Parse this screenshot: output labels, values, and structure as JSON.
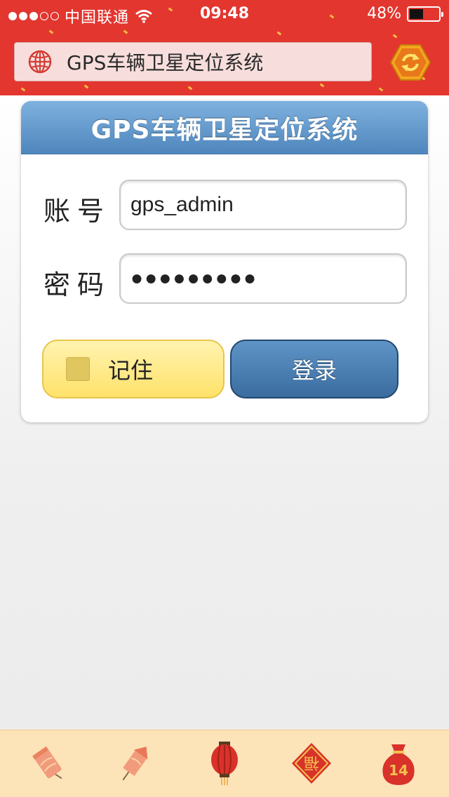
{
  "status_bar": {
    "signal_filled": 3,
    "signal_total": 5,
    "carrier": "中国联通",
    "time": "09:48",
    "battery": "48%",
    "battery_level": 0.48
  },
  "header": {
    "title": "GPS车辆卫星定位系统",
    "globe_icon": "globe-icon",
    "refresh_icon": "refresh-icon"
  },
  "login_card": {
    "title": "GPS车辆卫星定位系统",
    "account_label": "账号",
    "account_value": "gps_admin",
    "password_label": "密码",
    "password_value": "●●●●●●●●●",
    "remember_label": "记住",
    "login_label": "登录"
  },
  "bottom_bar": {
    "items": [
      {
        "icon": "firecracker-icon"
      },
      {
        "icon": "rocket-firework-icon"
      },
      {
        "icon": "lantern-icon"
      },
      {
        "icon": "fu-diamond-icon",
        "text": "福"
      },
      {
        "icon": "lucky-bag-icon",
        "text": "14"
      }
    ]
  },
  "colors": {
    "header_red": "#e2362f",
    "card_header_blue": "#5b90c5",
    "login_blue": "#3a6c9f",
    "remember_yellow": "#ffe26a",
    "bottom_bar": "#fde3b8"
  }
}
